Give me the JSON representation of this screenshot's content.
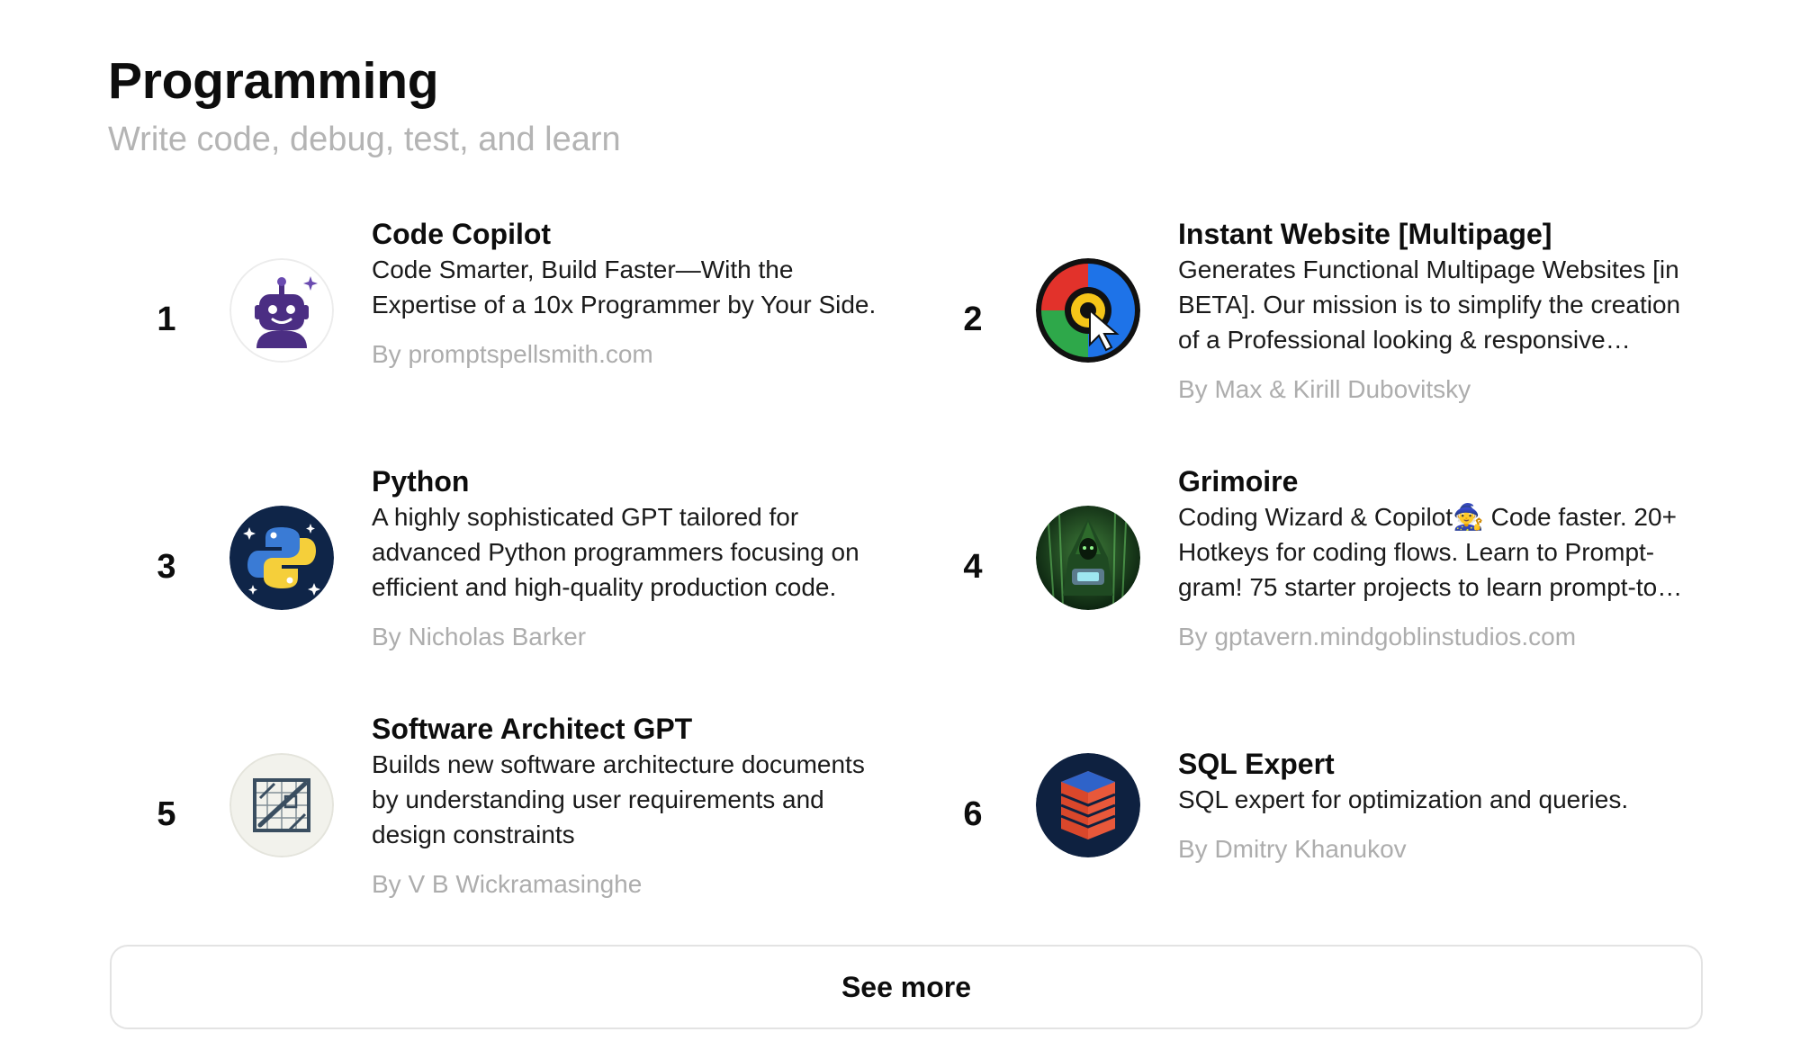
{
  "section": {
    "title": "Programming",
    "subtitle": "Write code, debug, test, and learn"
  },
  "gpts": [
    {
      "rank": "1",
      "name": "Code Copilot",
      "description": "Code Smarter, Build Faster—With the Expertise of a 10x Programmer by Your Side.",
      "author": "By promptspellsmith.com",
      "icon": "robot-icon"
    },
    {
      "rank": "2",
      "name": "Instant Website [Multipage]",
      "description": "Generates Functional Multipage Websites [in BETA]. Our mission is to simplify the creation of a Professional looking & responsive website.",
      "author": "By Max & Kirill Dubovitsky",
      "icon": "color-wheel-cursor-icon"
    },
    {
      "rank": "3",
      "name": "Python",
      "description": "A highly sophisticated GPT tailored for advanced Python programmers focusing on efficient and high-quality production code.",
      "author": "By Nicholas Barker",
      "icon": "python-logo-icon"
    },
    {
      "rank": "4",
      "name": "Grimoire",
      "description": "Coding Wizard & Copilot🧙 Code faster. 20+ Hotkeys for coding flows. Learn to Prompt-gram! 75 starter projects to learn prompt-to-code.",
      "author": "By gptavern.mindgoblinstudios.com",
      "icon": "wizard-icon"
    },
    {
      "rank": "5",
      "name": "Software Architect GPT",
      "description": "Builds new software architecture documents by understanding user requirements and design constraints",
      "author": "By V B Wickramasinghe",
      "icon": "blueprint-icon"
    },
    {
      "rank": "6",
      "name": "SQL Expert",
      "description": "SQL expert for optimization and queries.",
      "author": "By Dmitry Khanukov",
      "icon": "database-stack-icon"
    }
  ],
  "see_more_label": "See more"
}
